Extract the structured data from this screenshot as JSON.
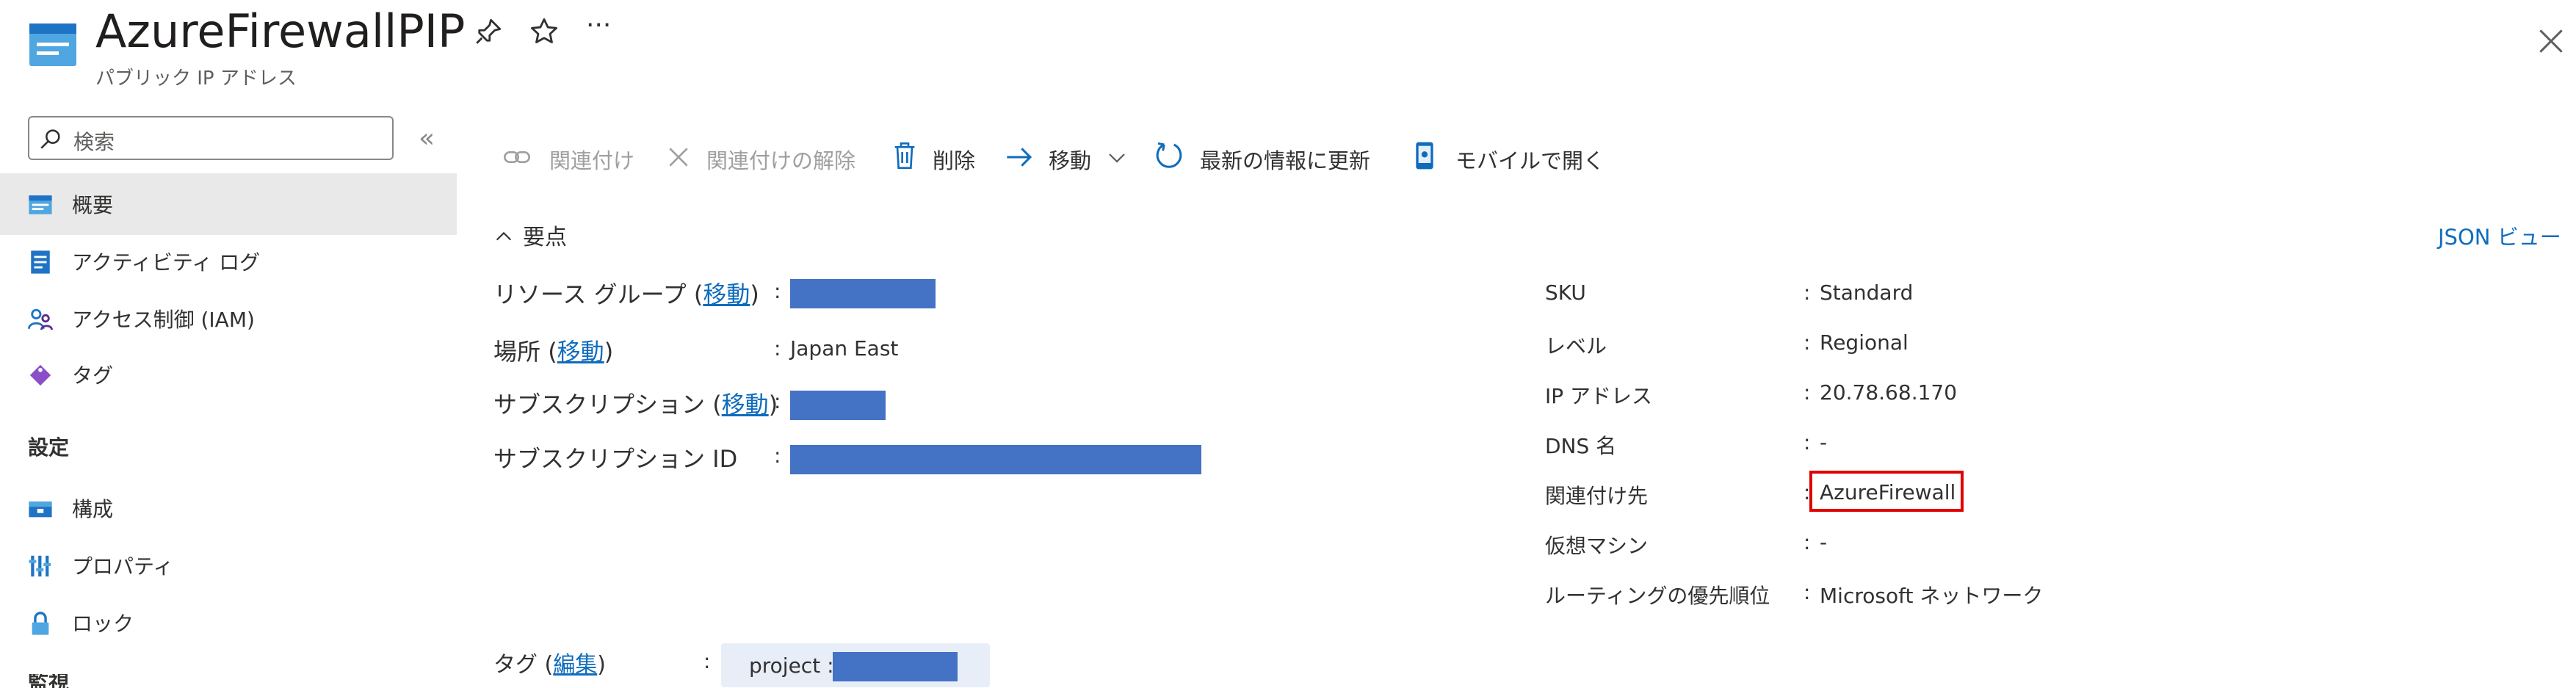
{
  "header": {
    "title": "AzureFirewallPIP",
    "subtitle": "パブリック IP アドレス",
    "more_label": "···"
  },
  "sidebar": {
    "search_placeholder": "検索",
    "collapse_label": "«",
    "items": [
      {
        "label": "概要",
        "icon": "overview-icon"
      },
      {
        "label": "アクティビティ ログ",
        "icon": "activity-log-icon"
      },
      {
        "label": "アクセス制御 (IAM)",
        "icon": "iam-icon"
      },
      {
        "label": "タグ",
        "icon": "tag-icon"
      }
    ],
    "section_settings": "設定",
    "settings_items": [
      {
        "label": "構成",
        "icon": "configuration-icon"
      },
      {
        "label": "プロパティ",
        "icon": "properties-icon"
      },
      {
        "label": "ロック",
        "icon": "lock-icon"
      }
    ],
    "section_partial": "監視"
  },
  "toolbar": {
    "associate": "関連付け",
    "dissociate": "関連付けの解除",
    "delete": "削除",
    "move": "移動",
    "refresh": "最新の情報に更新",
    "mobile": "モバイルで開く"
  },
  "essentials": {
    "header": "要点",
    "json_view": "JSON ビュー",
    "left": {
      "resource_group_label": "リソース グループ",
      "resource_group_link": "移動",
      "location_label": "場所",
      "location_link": "移動",
      "location_value": "Japan East",
      "subscription_label": "サブスクリプション",
      "subscription_link": "移動",
      "subscription_id_label": "サブスクリプション ID"
    },
    "right": {
      "sku_label": "SKU",
      "sku_value": "Standard",
      "tier_label": "レベル",
      "tier_value": "Regional",
      "ip_label": "IP アドレス",
      "ip_value": "20.78.68.170",
      "dns_label": "DNS 名",
      "dns_value": "-",
      "assoc_label": "関連付け先",
      "assoc_value": "AzureFirewall",
      "vm_label": "仮想マシン",
      "vm_value": "-",
      "routing_label": "ルーティングの優先順位",
      "routing_value": "Microsoft ネットワーク"
    },
    "tags_label": "タグ",
    "tags_link": "編集",
    "tag_key": "project :"
  },
  "colors": {
    "accent": "#0f6cbd",
    "redacted": "#4472c4",
    "highlight_box": "#e00000"
  }
}
